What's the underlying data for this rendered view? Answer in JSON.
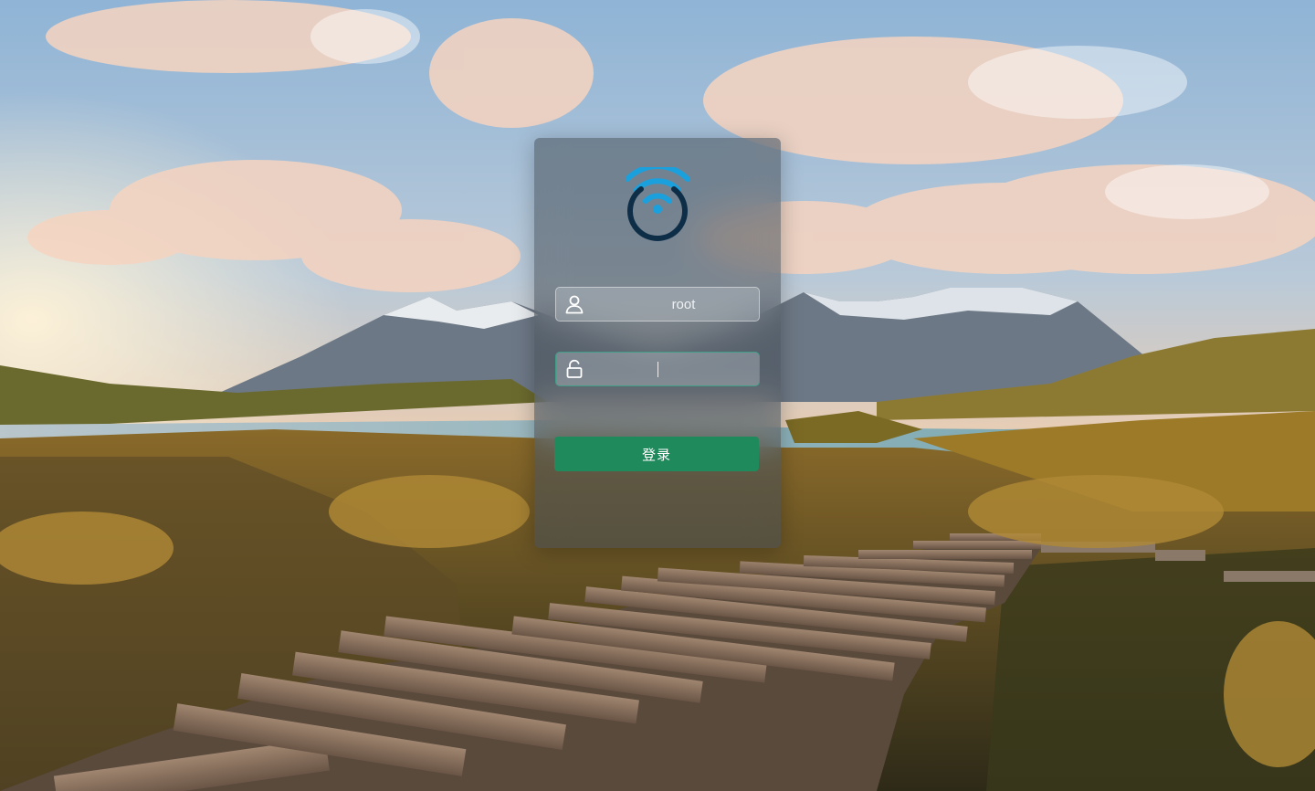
{
  "background": {
    "scene": "mountain-lake-boardwalk-photo"
  },
  "logo": {
    "icon": "wifi-router-logo-icon",
    "arc_color": "#1aa0dc",
    "ring_color": "#0e2e48"
  },
  "login": {
    "username_value": "root",
    "username_icon": "user-icon",
    "password_value": "",
    "password_icon": "unlock-icon",
    "submit_label": "登录",
    "accent_color": "#1f8a5c"
  }
}
